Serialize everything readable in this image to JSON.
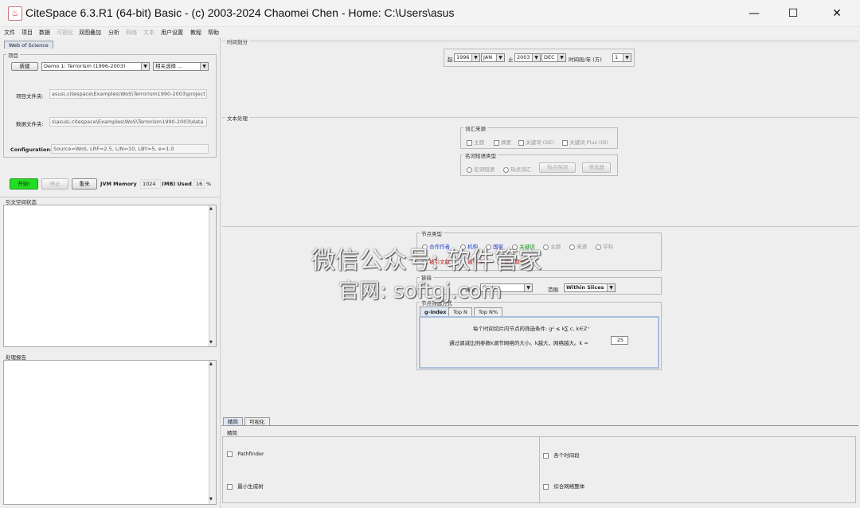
{
  "window": {
    "title": "CiteSpace 6.3.R1 (64-bit) Basic - (c) 2003-2024 Chaomei Chen - Home: C:\\Users\\asus",
    "minimize": "—",
    "maximize": "☐",
    "close": "✕"
  },
  "menu": [
    "文件",
    "项目",
    "数据",
    "可视化",
    "双图叠加",
    "分析",
    "网络",
    "文本",
    "用户设置",
    "教程",
    "帮助"
  ],
  "left": {
    "source_tab": "Web of Science",
    "project_group": "项目",
    "new_btn": "新建",
    "project_select": "Demo 1: Terrorism (1996-2003)",
    "related_select": "相关选择 ...",
    "project_dir_label": "项目文件夹:",
    "project_dir": "asus\\.citespace\\Examples\\WoS\\Terrorism1990-2003\\project",
    "data_dir_label": "数据文件夹:",
    "data_dir": "s\\asus\\.citespace\\Examples\\WoS\\Terrorism1990-2003\\data",
    "config_label": "Configuration:",
    "config": "Source=WoS, LRF=2.5, L/N=10, LBY=5, e=1.0",
    "start_btn": "开始!",
    "stop_btn": "停止",
    "reset_btn": "重来",
    "jvm_label": "JVM Memory",
    "jvm_value": "1024",
    "mb_label": "(MB) Used",
    "used_value": "16",
    "pct": "%",
    "citation_label": "引文空间状态",
    "process_label": "处理报告"
  },
  "time": {
    "label": "时间划分",
    "from": "起",
    "from_year": "1996",
    "from_month": "JAN",
    "to": "止",
    "to_year": "2003",
    "to_month": "DEC",
    "slice_label": "时间段/年 (方)",
    "slice_value": "1"
  },
  "text": {
    "label": "文本处理",
    "source_group": "词汇来源",
    "sources": [
      "主题",
      "摘要",
      "关键词 (DE)",
      "关键词 Plus (ID)"
    ],
    "noun_group": "名词短语类型",
    "noun_opts": [
      "名词短语",
      "热点词汇"
    ],
    "noun_btns": [
      "热点探测",
      "筛选器"
    ]
  },
  "node": {
    "type_label": "节点类型",
    "types_row1": [
      "合作作者",
      "机构",
      "国家",
      "关键词",
      "主题",
      "来源",
      "学科"
    ],
    "types_row2": [
      "被引文献",
      "被引作者",
      "被引期刊"
    ],
    "links_label": "链接",
    "strength_label": "强度",
    "strength": "Cosine",
    "scope_label": "范围",
    "scope": "Within Slices",
    "select_label": "节点筛选方式",
    "tabs": [
      "g-index",
      "Top N",
      "Top N%"
    ],
    "gindex_text": "每个时间切片内节点的筛选条件: g² ≤ k∑ c, k∈Z⁺",
    "scale_text": "通过调减比例参数k调节网络的大小。k越大，网络越大。k =",
    "k": "25"
  },
  "bottom": {
    "tabs": [
      "精简",
      "可视化"
    ],
    "group": "精简",
    "left_opts": [
      "Pathfinder",
      "最小生成树"
    ],
    "right_opts": [
      "各个时间段",
      "综合网络整体"
    ]
  },
  "watermark": {
    "line1": "微信公众号: 软件管家",
    "line2": "官网: softgj.com"
  }
}
